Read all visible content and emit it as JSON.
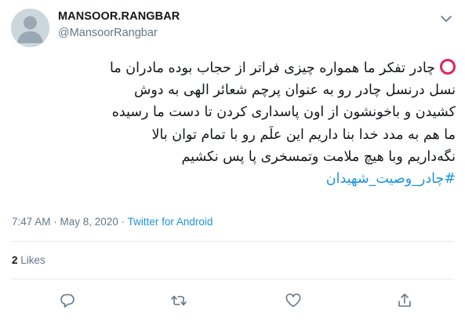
{
  "user": {
    "name": "MANSOOR.RANGBAR",
    "handle": "@MansoorRangbar"
  },
  "tweet": {
    "lines": [
      "چادر تفکر ما همواره چیزی فراتر از حجاب بوده مادران ما",
      "نسل درنسل چادر رو به عنوان پرچم شعائر الهی به دوش",
      "کشیدن و باخونشون از اون پاسداری کردن تا دست ما رسیده",
      "ما هم به مدد خدا بنا داریم این علَم رو با تمام توان بالا",
      "نگه‌داریم وبا هیچ ملامت وتمسخری پا پس نکشیم"
    ],
    "hashtag": "#چادر_وصیت_شهیدان",
    "lead_emoji": "red-circle-icon"
  },
  "meta": {
    "time": "7:47 AM",
    "separator": " · ",
    "date": "May 8, 2020",
    "source": "Twitter for Android"
  },
  "stats": {
    "likes_count": "2",
    "likes_label": "Likes"
  },
  "actions": {
    "icons": [
      "reply-icon",
      "retweet-icon",
      "like-icon",
      "share-icon"
    ]
  },
  "colors": {
    "link": "#1b95e0",
    "secondary_text": "#657786",
    "primary_text": "#14171a",
    "emoji_red": "#e0245e",
    "divider": "#e6ecf0"
  }
}
